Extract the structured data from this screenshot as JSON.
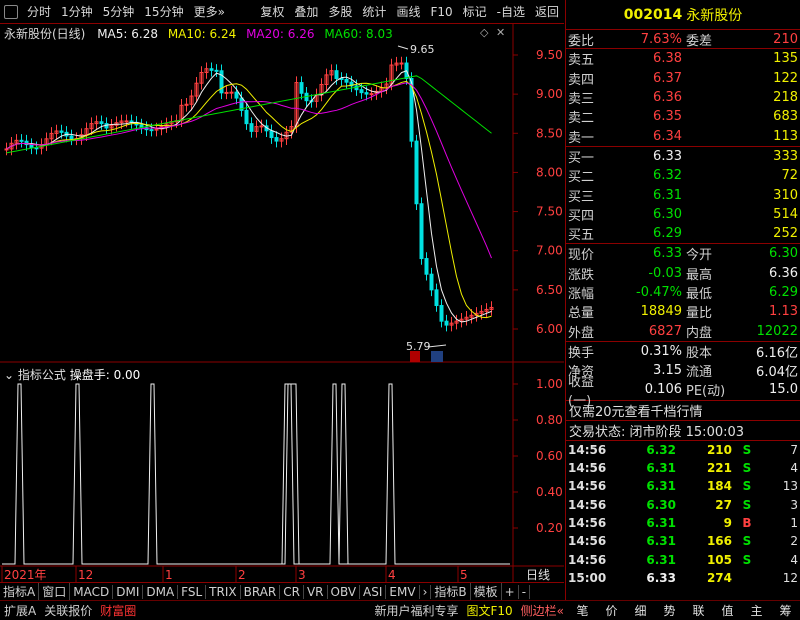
{
  "toolbar": {
    "items": [
      "分时",
      "1分钟",
      "5分钟",
      "15分钟",
      "更多»"
    ],
    "right_items": [
      "复权",
      "叠加",
      "多股",
      "统计",
      "画线",
      "F10",
      "标记",
      "-自选",
      "返回"
    ]
  },
  "chart": {
    "name": "永新股份(日线)",
    "ma5": "MA5: 6.28",
    "ma10": "MA10: 6.24",
    "ma20": "MA20: 6.26",
    "ma60": "MA60: 8.03",
    "high_label": "9.65",
    "low_label": "5.79",
    "y_ticks": [
      "9.50",
      "9.00",
      "8.50",
      "8.00",
      "7.50",
      "7.00",
      "6.50",
      "6.00"
    ]
  },
  "indicator": {
    "title": "指标公式",
    "name": "操盘手: 0.00",
    "y_ticks": [
      "1.00",
      "0.80",
      "0.60",
      "0.40",
      "0.20"
    ]
  },
  "axis": {
    "labels": [
      "2021年",
      "12",
      "1",
      "2",
      "3",
      "4",
      "5"
    ],
    "period": "日线"
  },
  "tabs": [
    "指标A",
    "窗口",
    "MACD",
    "DMI",
    "DMA",
    "FSL",
    "TRIX",
    "BRAR",
    "CR",
    "VR",
    "OBV",
    "ASI",
    "EMV",
    "›",
    "指标B",
    "模板",
    "+",
    "-"
  ],
  "status": {
    "left": [
      "扩展A",
      "关联报价",
      "财富圈"
    ],
    "promo": "新用户福利专享",
    "f10": "图文F10",
    "side": "侧边栏«",
    "right": [
      "笔",
      "价",
      "细",
      "势",
      "联",
      "值",
      "主",
      "筹"
    ]
  },
  "stock": {
    "code": "002014",
    "name": "永新股份"
  },
  "weibi": {
    "label": "委比",
    "value": "7.63%",
    "label2": "委差",
    "value2": "210"
  },
  "sells": [
    {
      "label": "卖五",
      "price": "6.38",
      "vol": "135"
    },
    {
      "label": "卖四",
      "price": "6.37",
      "vol": "122"
    },
    {
      "label": "卖三",
      "price": "6.36",
      "vol": "218"
    },
    {
      "label": "卖二",
      "price": "6.35",
      "vol": "683"
    },
    {
      "label": "卖一",
      "price": "6.34",
      "vol": "113"
    }
  ],
  "buys": [
    {
      "label": "买一",
      "price": "6.33",
      "vol": "333"
    },
    {
      "label": "买二",
      "price": "6.32",
      "vol": "72"
    },
    {
      "label": "买三",
      "price": "6.31",
      "vol": "310"
    },
    {
      "label": "买四",
      "price": "6.30",
      "vol": "514"
    },
    {
      "label": "买五",
      "price": "6.29",
      "vol": "252"
    }
  ],
  "quote": [
    {
      "l1": "现价",
      "v1": "6.33",
      "l2": "今开",
      "v2": "6.30"
    },
    {
      "l1": "涨跌",
      "v1": "-0.03",
      "l2": "最高",
      "v2": "6.36"
    },
    {
      "l1": "涨幅",
      "v1": "-0.47%",
      "l2": "最低",
      "v2": "6.29"
    },
    {
      "l1": "总量",
      "v1": "18849",
      "l2": "量比",
      "v2": "1.13"
    },
    {
      "l1": "外盘",
      "v1": "6827",
      "l2": "内盘",
      "v2": "12022"
    }
  ],
  "fund": [
    {
      "l1": "换手",
      "v1": "0.31%",
      "l2": "股本",
      "v2": "6.16亿"
    },
    {
      "l1": "净资",
      "v1": "3.15",
      "l2": "流通",
      "v2": "6.04亿"
    },
    {
      "l1": "收益(一)",
      "v1": "0.106",
      "l2": "PE(动)",
      "v2": "15.0"
    }
  ],
  "promo_line": "仅需20元查看千档行情",
  "trade_state": "交易状态: 闭市阶段 15:00:03",
  "ticks": [
    {
      "t": "14:56",
      "p": "6.32",
      "v": "210",
      "d": "S",
      "n": "7"
    },
    {
      "t": "14:56",
      "p": "6.31",
      "v": "221",
      "d": "S",
      "n": "4"
    },
    {
      "t": "14:56",
      "p": "6.31",
      "v": "184",
      "d": "S",
      "n": "13"
    },
    {
      "t": "14:56",
      "p": "6.30",
      "v": "27",
      "d": "S",
      "n": "3"
    },
    {
      "t": "14:56",
      "p": "6.31",
      "v": "9",
      "d": "B",
      "n": "1"
    },
    {
      "t": "14:56",
      "p": "6.31",
      "v": "166",
      "d": "S",
      "n": "2"
    },
    {
      "t": "14:56",
      "p": "6.31",
      "v": "105",
      "d": "S",
      "n": "4"
    },
    {
      "t": "15:00",
      "p": "6.33",
      "v": "274",
      "d": "",
      "n": "12"
    }
  ],
  "colors": {
    "up": "#ff4040",
    "down": "#00e000",
    "frame": "#8b0000"
  }
}
